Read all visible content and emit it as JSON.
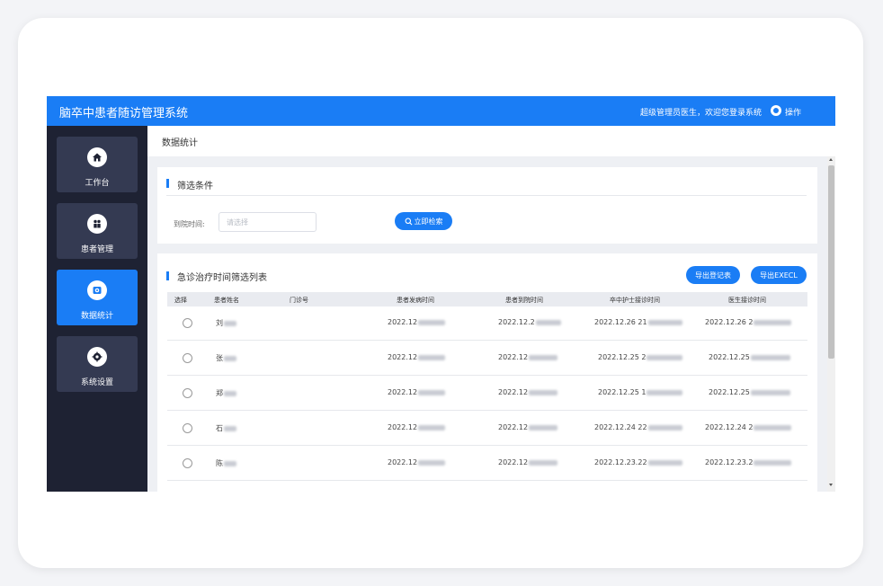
{
  "header": {
    "title": "脑卒中患者随访管理系统",
    "welcome": "超级管理员医生，欢迎您登录系统",
    "operation_label": "操作"
  },
  "sidebar": {
    "items": [
      {
        "label": "工作台",
        "icon": "home-icon",
        "active": false
      },
      {
        "label": "患者管理",
        "icon": "users-icon",
        "active": false
      },
      {
        "label": "数据统计",
        "icon": "chart-icon",
        "active": true
      },
      {
        "label": "系统设置",
        "icon": "settings-icon",
        "active": false
      }
    ]
  },
  "breadcrumb": "数据统计",
  "filter": {
    "title": "筛选条件",
    "time_label": "到院时间:",
    "time_placeholder": "请选择",
    "search_label": "立即检索"
  },
  "list": {
    "title": "急诊治疗时间筛选列表",
    "export_register_label": "导出登记表",
    "export_excel_label": "导出EXECL",
    "columns": [
      "选择",
      "患者姓名",
      "门诊号",
      "患者发病时间",
      "患者到院时间",
      "卒中护士接诊时间",
      "医生接诊时间"
    ],
    "rows": [
      {
        "name": "刘",
        "onset": "2022.12",
        "arrival": "2022.12.2",
        "nurse": "2022.12.26 21",
        "doctor": "2022.12.26 2"
      },
      {
        "name": "张",
        "onset": "2022.12",
        "arrival": "2022.12",
        "nurse": "2022.12.25 2",
        "doctor": "2022.12.25"
      },
      {
        "name": "郑",
        "onset": "2022.12",
        "arrival": "2022.12",
        "nurse": "2022.12.25 1",
        "doctor": "2022.12.25"
      },
      {
        "name": "石",
        "onset": "2022.12",
        "arrival": "2022.12",
        "nurse": "2022.12.24 22",
        "doctor": "2022.12.24 2"
      },
      {
        "name": "陈",
        "onset": "2022.12",
        "arrival": "2022.12",
        "nurse": "2022.12.23.22",
        "doctor": "2022.12.23.2"
      },
      {
        "name": "",
        "onset": "",
        "arrival": "",
        "nurse": "",
        "doctor": ""
      }
    ]
  },
  "colors": {
    "accent": "#1a7df5",
    "sidebar_bg": "#1e2233",
    "nav_item_bg": "#343a52"
  }
}
